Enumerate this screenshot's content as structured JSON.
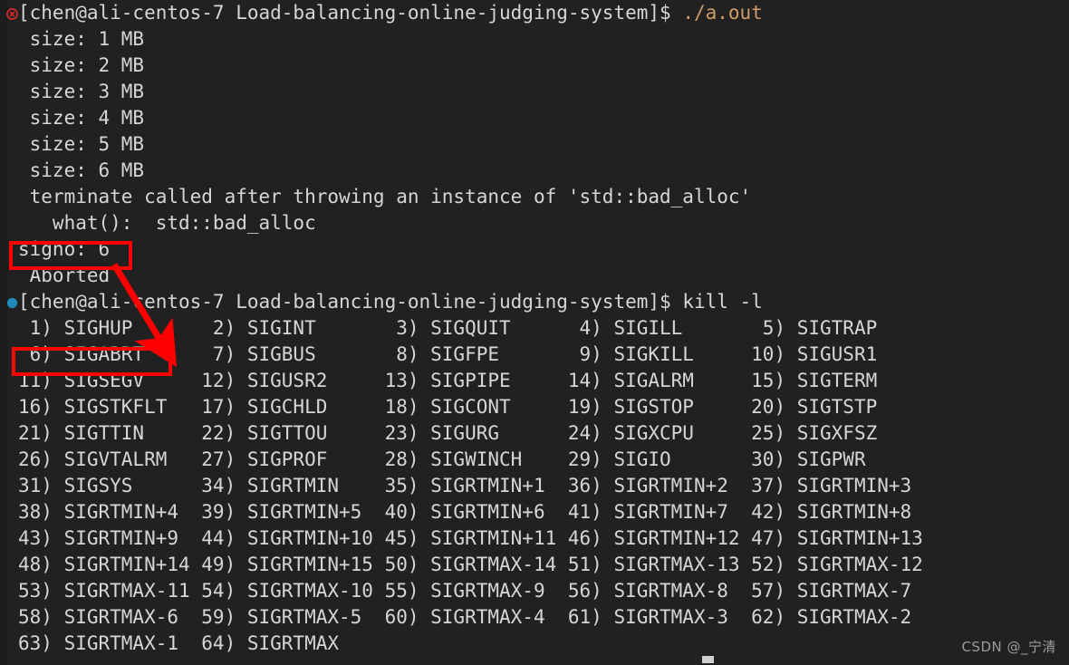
{
  "window": {
    "kind": "terminal",
    "background_color": "#212121",
    "foreground_color": "#d6d6d6",
    "accent_command_color": "#d19a66",
    "annotation_color": "#ff0000"
  },
  "terminal": {
    "lines": [
      {
        "marker": "error-marker",
        "segments": [
          {
            "text": "[chen@ali-centos-7 Load-balancing-online-judging-system]$ ",
            "style": "default"
          },
          {
            "text": "./a.out",
            "style": "command"
          }
        ]
      },
      {
        "marker": "",
        "segments": [
          {
            "text": " size: 1 MB",
            "style": "default"
          }
        ]
      },
      {
        "marker": "",
        "segments": [
          {
            "text": " size: 2 MB",
            "style": "default"
          }
        ]
      },
      {
        "marker": "",
        "segments": [
          {
            "text": " size: 3 MB",
            "style": "default"
          }
        ]
      },
      {
        "marker": "",
        "segments": [
          {
            "text": " size: 4 MB",
            "style": "default"
          }
        ]
      },
      {
        "marker": "",
        "segments": [
          {
            "text": " size: 5 MB",
            "style": "default"
          }
        ]
      },
      {
        "marker": "",
        "segments": [
          {
            "text": " size: 6 MB",
            "style": "default"
          }
        ]
      },
      {
        "marker": "",
        "segments": [
          {
            "text": " terminate called after throwing an instance of 'std::bad_alloc'",
            "style": "default"
          }
        ]
      },
      {
        "marker": "",
        "segments": [
          {
            "text": "   what():  std::bad_alloc",
            "style": "default"
          }
        ]
      },
      {
        "marker": "",
        "segments": [
          {
            "text": "signo: 6",
            "style": "default"
          }
        ]
      },
      {
        "marker": "",
        "segments": [
          {
            "text": " Aborted",
            "style": "default"
          }
        ]
      },
      {
        "marker": "ok-marker",
        "segments": [
          {
            "text": "[chen@ali-centos-7 Load-balancing-online-judging-system]$ ",
            "style": "default"
          },
          {
            "text": "kill -l",
            "style": "default"
          }
        ]
      },
      {
        "marker": "",
        "segments": [
          {
            "text": " 1) SIGHUP       2) SIGINT       3) SIGQUIT      4) SIGILL       5) SIGTRAP",
            "style": "default"
          }
        ]
      },
      {
        "marker": "",
        "segments": [
          {
            "text": " 6) SIGABRT      7) SIGBUS       8) SIGFPE       9) SIGKILL     10) SIGUSR1",
            "style": "default"
          }
        ]
      },
      {
        "marker": "",
        "segments": [
          {
            "text": "11) SIGSEGV     12) SIGUSR2     13) SIGPIPE     14) SIGALRM     15) SIGTERM",
            "style": "default"
          }
        ]
      },
      {
        "marker": "",
        "segments": [
          {
            "text": "16) SIGSTKFLT   17) SIGCHLD     18) SIGCONT     19) SIGSTOP     20) SIGTSTP",
            "style": "default"
          }
        ]
      },
      {
        "marker": "",
        "segments": [
          {
            "text": "21) SIGTTIN     22) SIGTTOU     23) SIGURG      24) SIGXCPU     25) SIGXFSZ",
            "style": "default"
          }
        ]
      },
      {
        "marker": "",
        "segments": [
          {
            "text": "26) SIGVTALRM   27) SIGPROF     28) SIGWINCH    29) SIGIO       30) SIGPWR",
            "style": "default"
          }
        ]
      },
      {
        "marker": "",
        "segments": [
          {
            "text": "31) SIGSYS      34) SIGRTMIN    35) SIGRTMIN+1  36) SIGRTMIN+2  37) SIGRTMIN+3",
            "style": "default"
          }
        ]
      },
      {
        "marker": "",
        "segments": [
          {
            "text": "38) SIGRTMIN+4  39) SIGRTMIN+5  40) SIGRTMIN+6  41) SIGRTMIN+7  42) SIGRTMIN+8",
            "style": "default"
          }
        ]
      },
      {
        "marker": "",
        "segments": [
          {
            "text": "43) SIGRTMIN+9  44) SIGRTMIN+10 45) SIGRTMIN+11 46) SIGRTMIN+12 47) SIGRTMIN+13",
            "style": "default"
          }
        ]
      },
      {
        "marker": "",
        "segments": [
          {
            "text": "48) SIGRTMIN+14 49) SIGRTMIN+15 50) SIGRTMAX-14 51) SIGRTMAX-13 52) SIGRTMAX-12",
            "style": "default"
          }
        ]
      },
      {
        "marker": "",
        "segments": [
          {
            "text": "53) SIGRTMAX-11 54) SIGRTMAX-10 55) SIGRTMAX-9  56) SIGRTMAX-8  57) SIGRTMAX-7",
            "style": "default"
          }
        ]
      },
      {
        "marker": "",
        "segments": [
          {
            "text": "58) SIGRTMAX-6  59) SIGRTMAX-5  60) SIGRTMAX-4  61) SIGRTMAX-3  62) SIGRTMAX-2",
            "style": "default"
          }
        ]
      },
      {
        "marker": "",
        "segments": [
          {
            "text": "63) SIGRTMAX-1  64) SIGRTMAX",
            "style": "default"
          }
        ]
      }
    ]
  },
  "annotations": {
    "box_signo_label": "signo: 6",
    "box_sigabrt_label": "6) SIGABRT",
    "arrow_from": "signo: 6",
    "arrow_to": "6) SIGABRT"
  },
  "watermark": {
    "text": "CSDN @_宁清"
  }
}
